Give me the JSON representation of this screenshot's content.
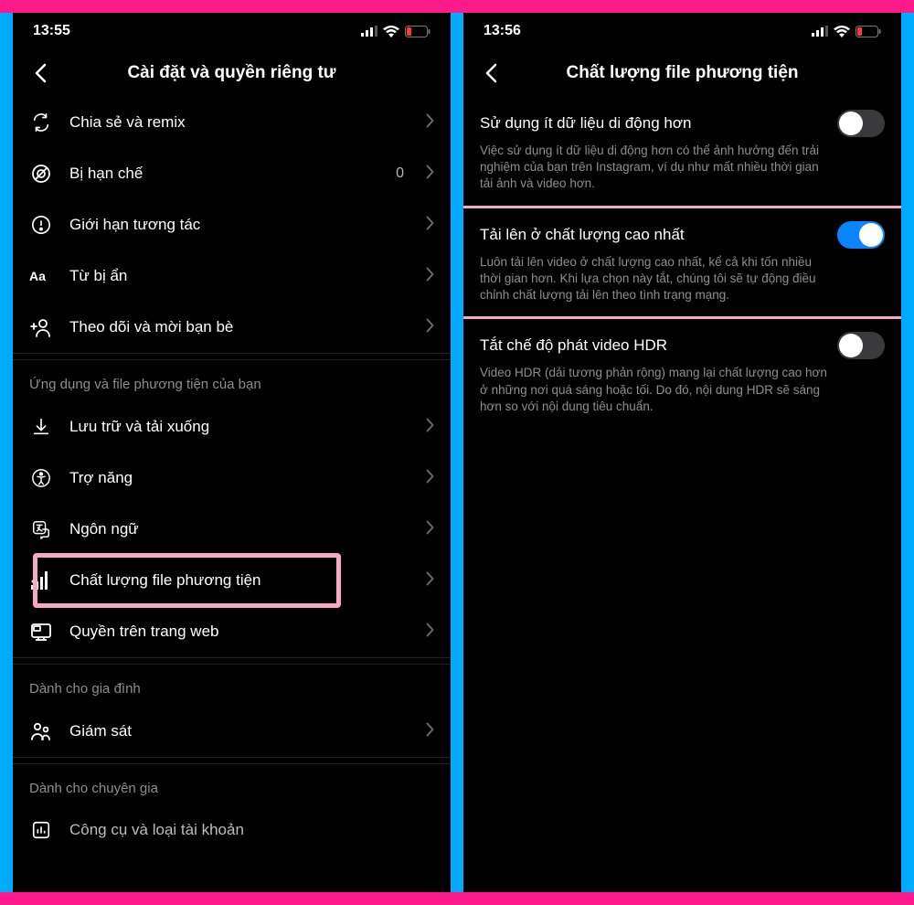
{
  "left": {
    "status": {
      "time": "13:55"
    },
    "header": {
      "title": "Cài đặt và quyền riêng tư"
    },
    "rows_top": [
      {
        "label": "Chia sẻ và remix",
        "icon": "remix-icon",
        "value": ""
      },
      {
        "label": "Bị hạn chế",
        "icon": "restricted-icon",
        "value": "0"
      },
      {
        "label": "Giới hạn tương tác",
        "icon": "limit-icon",
        "value": ""
      },
      {
        "label": "Từ bị ẩn",
        "icon": "hidden-words-icon",
        "value": ""
      },
      {
        "label": "Theo dõi và mời bạn bè",
        "icon": "invite-icon",
        "value": ""
      }
    ],
    "section_apps_media": "Ứng dụng và file phương tiện của bạn",
    "rows_media": [
      {
        "label": "Lưu trữ và tải xuống",
        "icon": "download-icon"
      },
      {
        "label": "Trợ năng",
        "icon": "accessibility-icon"
      },
      {
        "label": "Ngôn ngữ",
        "icon": "language-icon"
      },
      {
        "label": "Chất lượng file phương tiện",
        "icon": "signal-icon",
        "highlight": true
      },
      {
        "label": "Quyền trên trang web",
        "icon": "web-icon"
      }
    ],
    "section_family": "Dành cho gia đình",
    "rows_family": [
      {
        "label": "Giám sát",
        "icon": "supervision-icon"
      }
    ],
    "section_pro": "Dành cho chuyên gia",
    "truncated_row": {
      "label": "Công cụ và loại tài khoản",
      "icon": "tools-icon"
    }
  },
  "right": {
    "status": {
      "time": "13:56"
    },
    "header": {
      "title": "Chất lượng file phương tiện"
    },
    "settings": [
      {
        "title": "Sử dụng ít dữ liệu di động hơn",
        "desc": "Việc sử dụng ít dữ liệu di động hơn có thể ảnh hưởng đến trải nghiệm của bạn trên Instagram, ví dụ như mất nhiều thời gian tải ảnh và video hơn.",
        "on": false
      },
      {
        "title": "Tải lên ở chất lượng cao nhất",
        "desc": "Luôn tải lên video ở chất lượng cao nhất, kể cả khi tốn nhiều thời gian hơn. Khi lựa chọn này tắt, chúng tôi sẽ tự động điều chỉnh chất lượng tải lên theo tình trạng mạng.",
        "on": true
      },
      {
        "title": "Tắt chế độ phát video HDR",
        "desc": "Video HDR (dải tương phản rộng) mang lại chất lượng cao hơn ở những nơi quá sáng hoặc tối. Do đó, nội dung HDR sẽ sáng hơn so với nội dung tiêu chuẩn.",
        "on": false
      }
    ]
  }
}
